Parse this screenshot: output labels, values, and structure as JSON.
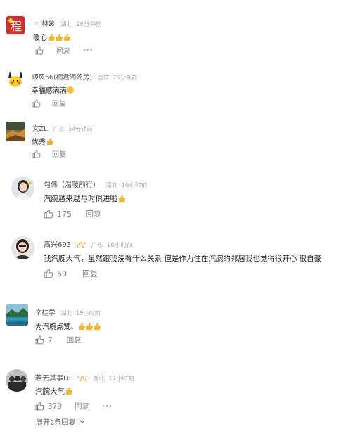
{
  "colors": {
    "meta": "#aaaaaa",
    "name": "#555555",
    "text": "#222222",
    "thumb": "#f2b531",
    "accent": "#e8a020"
  },
  "comments": [
    {
      "name_prefix": "☞",
      "name": "林ꕤ",
      "location": "湖北",
      "time": "18分钟前",
      "text": "暖心",
      "thumbs": 3,
      "reply_label": "回复",
      "avatar": "cheng-red-square"
    },
    {
      "name": "顺风66(桐君阁药房)",
      "location": "重庆",
      "time": "25分钟前",
      "text": "幸福感满满",
      "reply_label": "回复",
      "avatar": "pikachu"
    },
    {
      "name": "文ZL",
      "location": "广东",
      "time": "34分钟前",
      "text": "优秀",
      "thumbs": 1,
      "reply_label": "回复",
      "avatar": "landscape"
    },
    {
      "name": "勾伟（温暖前行）",
      "location": "湖北",
      "time": "16小时前",
      "text": "汽腕越来越与时俱进啦",
      "thumbs": 1,
      "likes": "175",
      "reply_label": "回复",
      "avatar": "girl"
    },
    {
      "name": "高兴693",
      "location": "广东",
      "time": "16小时前",
      "text": "我汽腕大气，虽然跟我没有什么关系 但是作为住在汽腕的邻居我也觉得很开心 很自豪",
      "likes": "60",
      "reply_label": "回复",
      "avatar": "woman",
      "badge": "\\/\\/"
    },
    {
      "name": "辛桂学",
      "location": "湖北",
      "time": "15小时前",
      "text": "为汽腕点赞。",
      "thumbs": 3,
      "likes": "7",
      "reply_label": "回复",
      "avatar": "lake"
    },
    {
      "name": "若无其事DL",
      "location": "湖北",
      "time": "17小时前",
      "text": "汽腕大气",
      "thumbs": 1,
      "likes": "370",
      "reply_label": "回复",
      "avatar": "bw-group",
      "badge": "\\/\\/",
      "expand_label": "展开2条回复"
    }
  ]
}
